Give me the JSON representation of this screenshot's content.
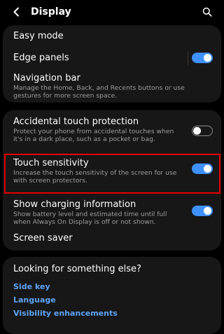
{
  "header": {
    "title": "Display",
    "back_icon": "chevron-left-icon",
    "search_icon": "search-icon"
  },
  "settings": {
    "easy_mode": {
      "title": "Easy mode"
    },
    "edge_panels": {
      "title": "Edge panels",
      "enabled": true
    },
    "navigation_bar": {
      "title": "Navigation bar",
      "description": "Manage the Home, Back, and Recents buttons or use gestures for more screen space."
    },
    "accidental_touch": {
      "title": "Accidental touch protection",
      "description": "Protect your phone from accidental touches when it's in a dark place, such as a pocket or bag.",
      "enabled": false
    },
    "touch_sensitivity": {
      "title": "Touch sensitivity",
      "description": "Increase the touch sensitivity of the screen for use with screen protectors.",
      "enabled": true
    },
    "charging_info": {
      "title": "Show charging information",
      "description": "Show battery level and estimated time until full when Always On Display is off or not shown.",
      "enabled": true
    },
    "screen_saver": {
      "title": "Screen saver"
    }
  },
  "suggestions": {
    "title": "Looking for something else?",
    "links": [
      "Side key",
      "Language",
      "Visibility enhancements"
    ]
  },
  "colors": {
    "background": "#000000",
    "card": "#171717",
    "toggle_on": "#3e91ff",
    "link": "#5fa3f6",
    "highlight": "#e60000"
  }
}
